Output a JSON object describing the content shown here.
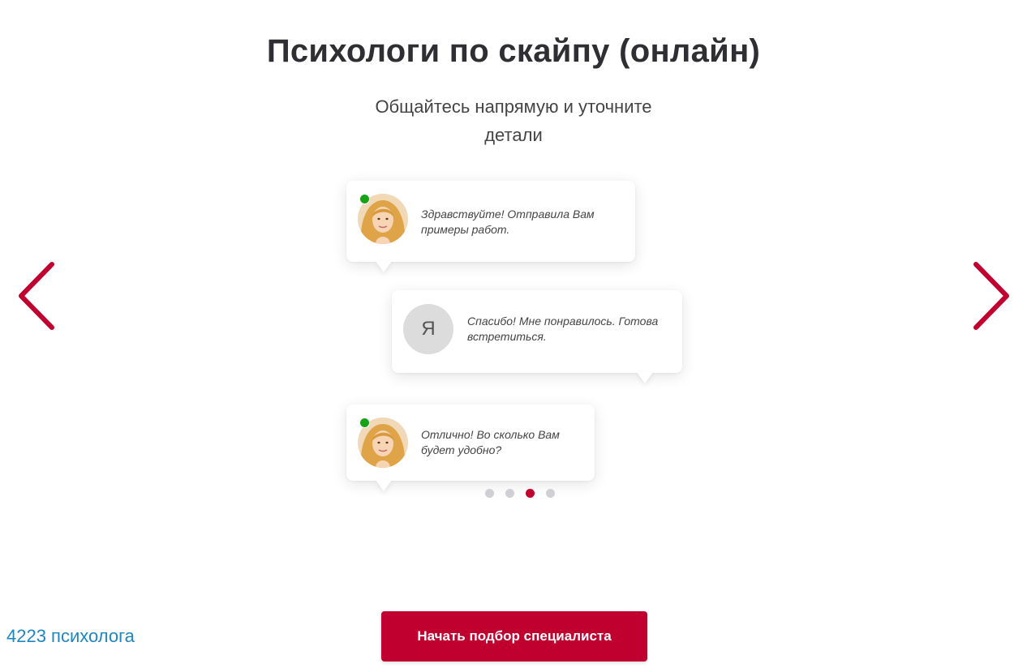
{
  "header": {
    "title": "Психологи по скайпу (онлайн)"
  },
  "slide": {
    "subtitle": "Общайтесь напрямую и уточните детали",
    "messages": [
      {
        "sender": "specialist",
        "text": "Здравствуйте! Отправила Вам примеры работ.",
        "online": true
      },
      {
        "sender": "user",
        "avatar_letter": "Я",
        "text": "Спасибо! Мне понравилось. Готова встретиться."
      },
      {
        "sender": "specialist",
        "text": "Отлично! Во сколько Вам будет удобно?",
        "online": true
      }
    ]
  },
  "carousel": {
    "prev_icon": "chevron-left-icon",
    "next_icon": "chevron-right-icon",
    "dots_count": 4,
    "active_index": 2
  },
  "footer": {
    "count_link": "4223 психолога",
    "cta_label": "Начать подбор специалиста"
  },
  "colors": {
    "accent": "#c0002e",
    "link": "#1e86c0",
    "online": "#18a317",
    "dot_inactive": "#cfcfd4"
  }
}
